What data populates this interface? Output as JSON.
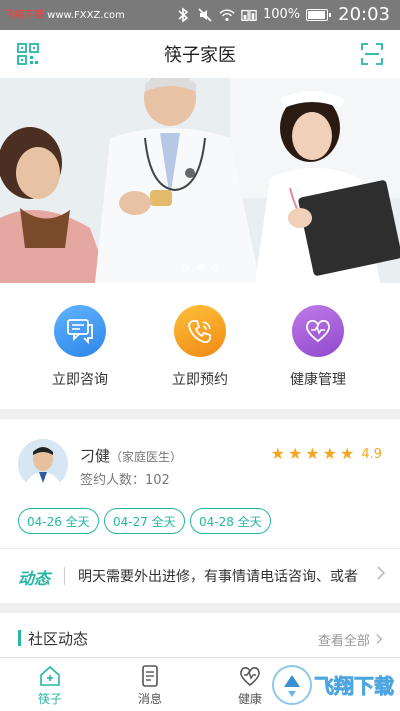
{
  "status_bar": {
    "left_text_red": "飞翔下载",
    "left_text": " www.FXXZ.com",
    "battery": "100%",
    "battery_level": 1.0,
    "time": "20:03"
  },
  "header": {
    "title": "筷子家医",
    "left_icon": "qr-code-icon",
    "right_icon": "scan-icon"
  },
  "banner": {
    "slide_count": 3,
    "active_slide": 1
  },
  "actions": [
    {
      "label": "立即咨询",
      "icon": "chat-icon",
      "color": "#3d95ee"
    },
    {
      "label": "立即预约",
      "icon": "phone-icon",
      "color": "#f5a023"
    },
    {
      "label": "健康管理",
      "icon": "heart-icon",
      "color": "#a35bd8"
    }
  ],
  "doctor": {
    "name": "刁健",
    "role": "（家庭医生）",
    "signed_count": "签约人数：102",
    "stars": 5,
    "rating": "4.9",
    "dates": [
      "04-26 全天",
      "04-27 全天",
      "04-28 全天"
    ]
  },
  "news": {
    "tag": "动态",
    "text": "明天需要外出进修，有事情请电话咨询、或者"
  },
  "community": {
    "title": "社区动态",
    "more": "查看全部"
  },
  "tabs": [
    {
      "label": "筷子",
      "icon": "home-icon",
      "active": true
    },
    {
      "label": "消息",
      "icon": "message-icon",
      "active": false
    },
    {
      "label": "健康",
      "icon": "health-icon",
      "active": false
    }
  ],
  "watermark": "飞翔下载",
  "colors": {
    "accent": "#25b7a4",
    "star": "#f5a623"
  }
}
